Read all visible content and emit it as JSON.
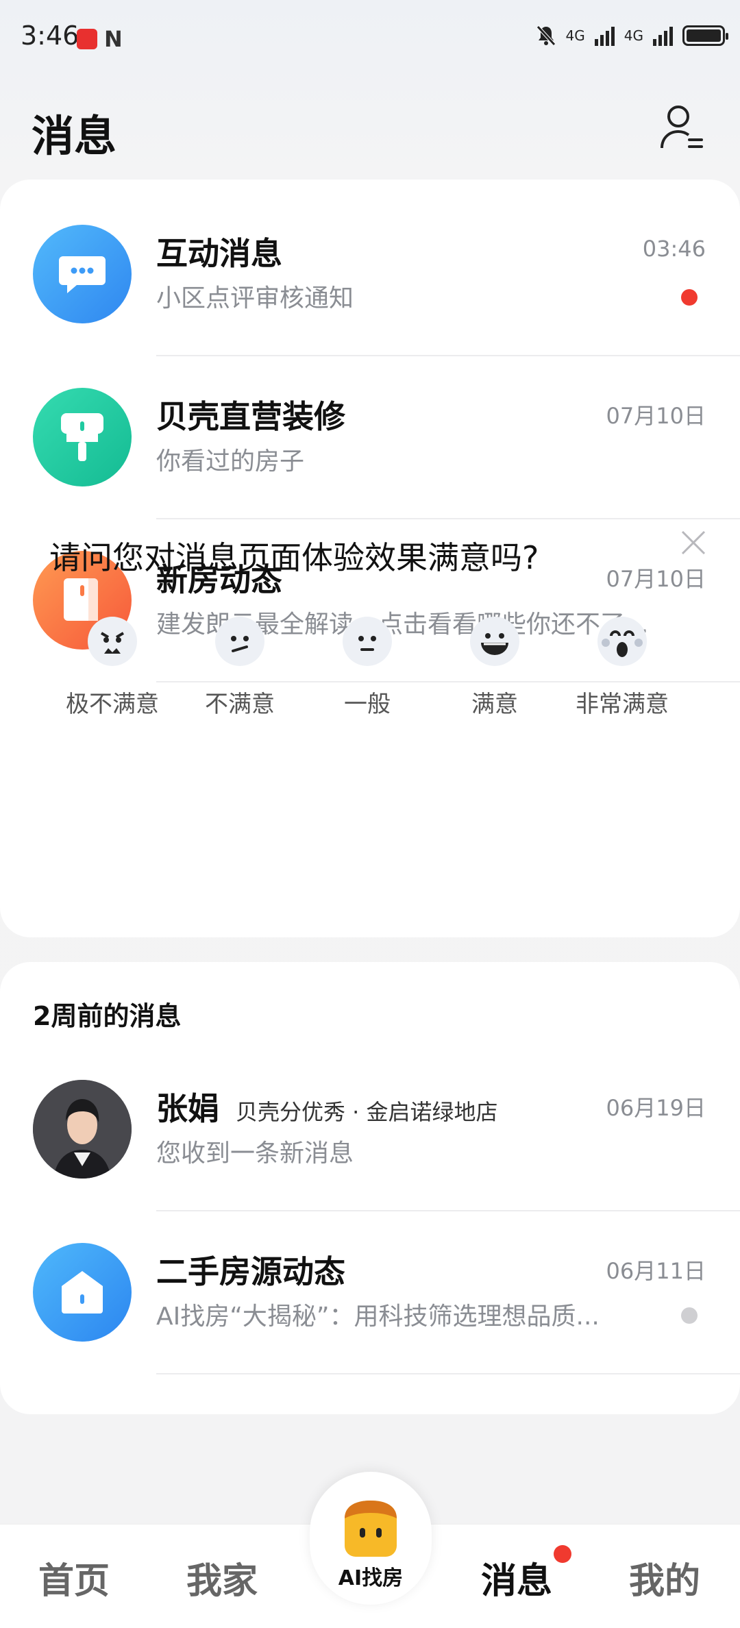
{
  "status_bar": {
    "time": "3:46",
    "nfc": "N",
    "net1": "4G",
    "net2": "4G"
  },
  "header": {
    "title": "消息"
  },
  "messages": [
    {
      "title": "互动消息",
      "subtitle": "小区点评审核通知",
      "time": "03:46",
      "unread": true,
      "icon": "chat-bubble-icon",
      "color": "#3d9bf7"
    },
    {
      "title": "贝壳直营装修",
      "subtitle": "你看过的房子",
      "time": "07月10日",
      "unread": false,
      "icon": "paint-roller-icon",
      "color": "#1fcaa0"
    },
    {
      "title": "新房动态",
      "subtitle": "建发朗云最全解读，点击看看哪些你还不了...",
      "time": "07月10日",
      "unread": false,
      "icon": "building-icon",
      "color": "#fb7a45"
    }
  ],
  "survey": {
    "question": "请问您对消息页面体验效果满意吗?",
    "options": [
      "极不满意",
      "不满意",
      "一般",
      "满意",
      "非常满意"
    ]
  },
  "older": {
    "section_title": "2周前的消息",
    "items": [
      {
        "title": "张娟",
        "tags": "贝壳分优秀 · 金启诺绿地店",
        "subtitle": "您收到一条新消息",
        "time": "06月19日",
        "unread": false
      },
      {
        "title": "二手房源动态",
        "subtitle": "AI找房“大揭秘”：用科技筛选理想品质...",
        "time": "06月11日",
        "muted_dot": true
      }
    ]
  },
  "nav": {
    "home": "首页",
    "my_home": "我家",
    "ai": "AI找房",
    "messages": "消息",
    "mine": "我的"
  },
  "colors": {
    "unread_red": "#f03a2f",
    "muted_dot": "#cfcfd2"
  }
}
